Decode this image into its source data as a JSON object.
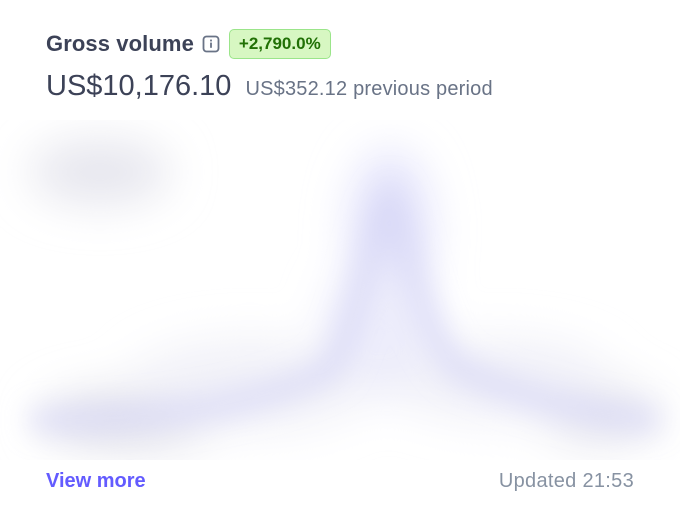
{
  "widget": {
    "title": "Gross volume",
    "info_icon": "info-icon",
    "change_badge": "+2,790.0%",
    "current_value": "US$10,176.10",
    "previous_value": "US$352.12 previous period",
    "view_more_label": "View more",
    "updated_text": "Updated 21:53"
  },
  "colors": {
    "title": "#3c4257",
    "badge_bg": "#d7f7c2",
    "badge_border": "#9be58a",
    "badge_text": "#217005",
    "link": "#635bff",
    "muted": "#8792a2",
    "chart_blur": "#dcdcf7"
  }
}
